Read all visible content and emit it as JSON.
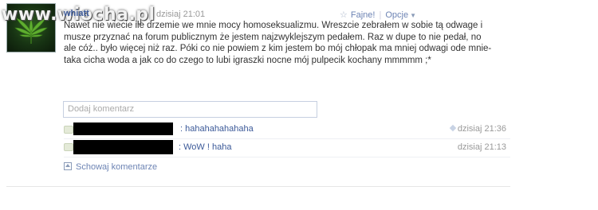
{
  "post": {
    "author": "whiatt",
    "date": "dzisiaj 21:01",
    "watermark": "www.wiocha.pl",
    "actions": {
      "like": "Fajne!",
      "options": "Opcje"
    },
    "text": "Nawet nie wiecie ile drzemie we mnie mocy homoseksualizmu. Wreszcie zebrałem w sobie tą odwage i musze przyznać na forum publicznym że jestem najzwyklejszym pedałem. Raz w dupe to nie pedał, no ale cóż.. było więcej niż raz. Póki co nie powiem z kim jestem bo mój chłopak ma mniej odwagi ode mnie- taka cicha woda a jak co do czego to lubi igraszki nocne mój pulpecik kochany mmmmm ;*"
  },
  "comment_input": {
    "placeholder": "Dodaj komentarz"
  },
  "comments": [
    {
      "text": ": hahahahahahaha",
      "time": "dzisiaj 21:36"
    },
    {
      "text": ": WoW ! haha",
      "time": "dzisiaj 21:13"
    }
  ],
  "hide_comments_label": "Schowaj komentarze",
  "colors": {
    "link": "#3b5998",
    "muted": "#999999",
    "border": "#c6cfe0"
  }
}
